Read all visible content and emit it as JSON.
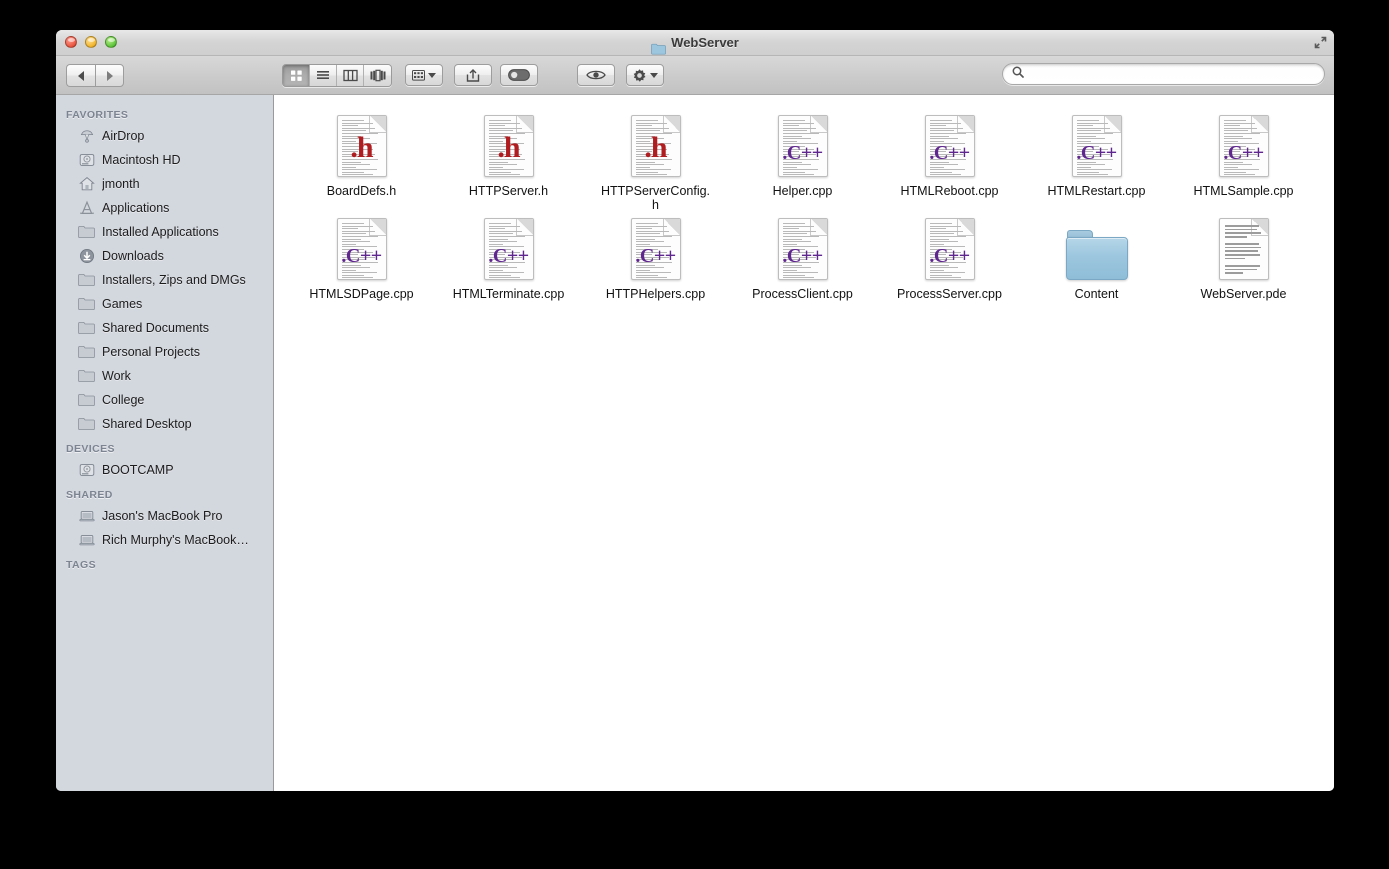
{
  "window": {
    "title": "WebServer",
    "title_icon": "folder-icon",
    "traffic_lights": [
      "close-button",
      "minimize-button",
      "zoom-button"
    ],
    "fullscreen_icon": "fullscreen-expand-icon"
  },
  "toolbar": {
    "back_label": "Back",
    "forward_label": "Forward",
    "view_modes": [
      {
        "name": "icon-view",
        "icon": "grid-icon",
        "active": true
      },
      {
        "name": "list-view",
        "icon": "list-icon",
        "active": false
      },
      {
        "name": "column-view",
        "icon": "columns-icon",
        "active": false
      },
      {
        "name": "coverflow-view",
        "icon": "coverflow-icon",
        "active": false
      }
    ],
    "arrange_label": "Arrange",
    "share_label": "Share",
    "tag_label": "Tag",
    "quicklook_label": "Quick Look",
    "action_label": "Action"
  },
  "search": {
    "value": "",
    "placeholder": "",
    "icon": "search-icon"
  },
  "sidebar": {
    "sections": [
      {
        "header": "FAVORITES",
        "items": [
          {
            "label": "AirDrop",
            "icon": "airdrop-icon"
          },
          {
            "label": "Macintosh HD",
            "icon": "harddisk-icon"
          },
          {
            "label": "jmonth",
            "icon": "home-icon"
          },
          {
            "label": "Applications",
            "icon": "applications-icon"
          },
          {
            "label": "Installed Applications",
            "icon": "folder-icon"
          },
          {
            "label": "Downloads",
            "icon": "downloads-icon"
          },
          {
            "label": "Installers, Zips and DMGs",
            "icon": "folder-icon"
          },
          {
            "label": "Games",
            "icon": "folder-icon"
          },
          {
            "label": "Shared Documents",
            "icon": "folder-icon"
          },
          {
            "label": "Personal Projects",
            "icon": "folder-icon"
          },
          {
            "label": "Work",
            "icon": "folder-icon"
          },
          {
            "label": "College",
            "icon": "folder-icon"
          },
          {
            "label": "Shared Desktop",
            "icon": "folder-icon"
          }
        ]
      },
      {
        "header": "DEVICES",
        "items": [
          {
            "label": "BOOTCAMP",
            "icon": "harddisk-icon"
          }
        ]
      },
      {
        "header": "SHARED",
        "items": [
          {
            "label": "Jason's MacBook Pro",
            "icon": "laptop-icon"
          },
          {
            "label": "Rich Murphy's MacBook…",
            "icon": "laptop-icon"
          }
        ]
      },
      {
        "header": "TAGS",
        "items": []
      }
    ]
  },
  "content": {
    "files": [
      {
        "name": "BoardDefs.h",
        "kind": "header",
        "badge": ".h"
      },
      {
        "name": "HTTPServer.h",
        "kind": "header",
        "badge": ".h"
      },
      {
        "name": "HTTPServerConfig.h",
        "kind": "header",
        "badge": ".h"
      },
      {
        "name": "Helper.cpp",
        "kind": "source",
        "badge": ".C++"
      },
      {
        "name": "HTMLReboot.cpp",
        "kind": "source",
        "badge": ".C++"
      },
      {
        "name": "HTMLRestart.cpp",
        "kind": "source",
        "badge": ".C++"
      },
      {
        "name": "HTMLSample.cpp",
        "kind": "source",
        "badge": ".C++"
      },
      {
        "name": "HTMLSDPage.cpp",
        "kind": "source",
        "badge": ".C++"
      },
      {
        "name": "HTMLTerminate.cpp",
        "kind": "source",
        "badge": ".C++"
      },
      {
        "name": "HTTPHelpers.cpp",
        "kind": "source",
        "badge": ".C++"
      },
      {
        "name": "ProcessClient.cpp",
        "kind": "source",
        "badge": ".C++"
      },
      {
        "name": "ProcessServer.cpp",
        "kind": "source",
        "badge": ".C++"
      },
      {
        "name": "Content",
        "kind": "folder",
        "badge": ""
      },
      {
        "name": "WebServer.pde",
        "kind": "plain",
        "badge": ""
      }
    ]
  },
  "colors": {
    "header_badge_red": "#b01d20",
    "source_badge_purple": "#60268f",
    "sidebar_bg": "#d3d7de",
    "folder_blue": "#9cc6de",
    "desktop_bg": "#000000"
  }
}
